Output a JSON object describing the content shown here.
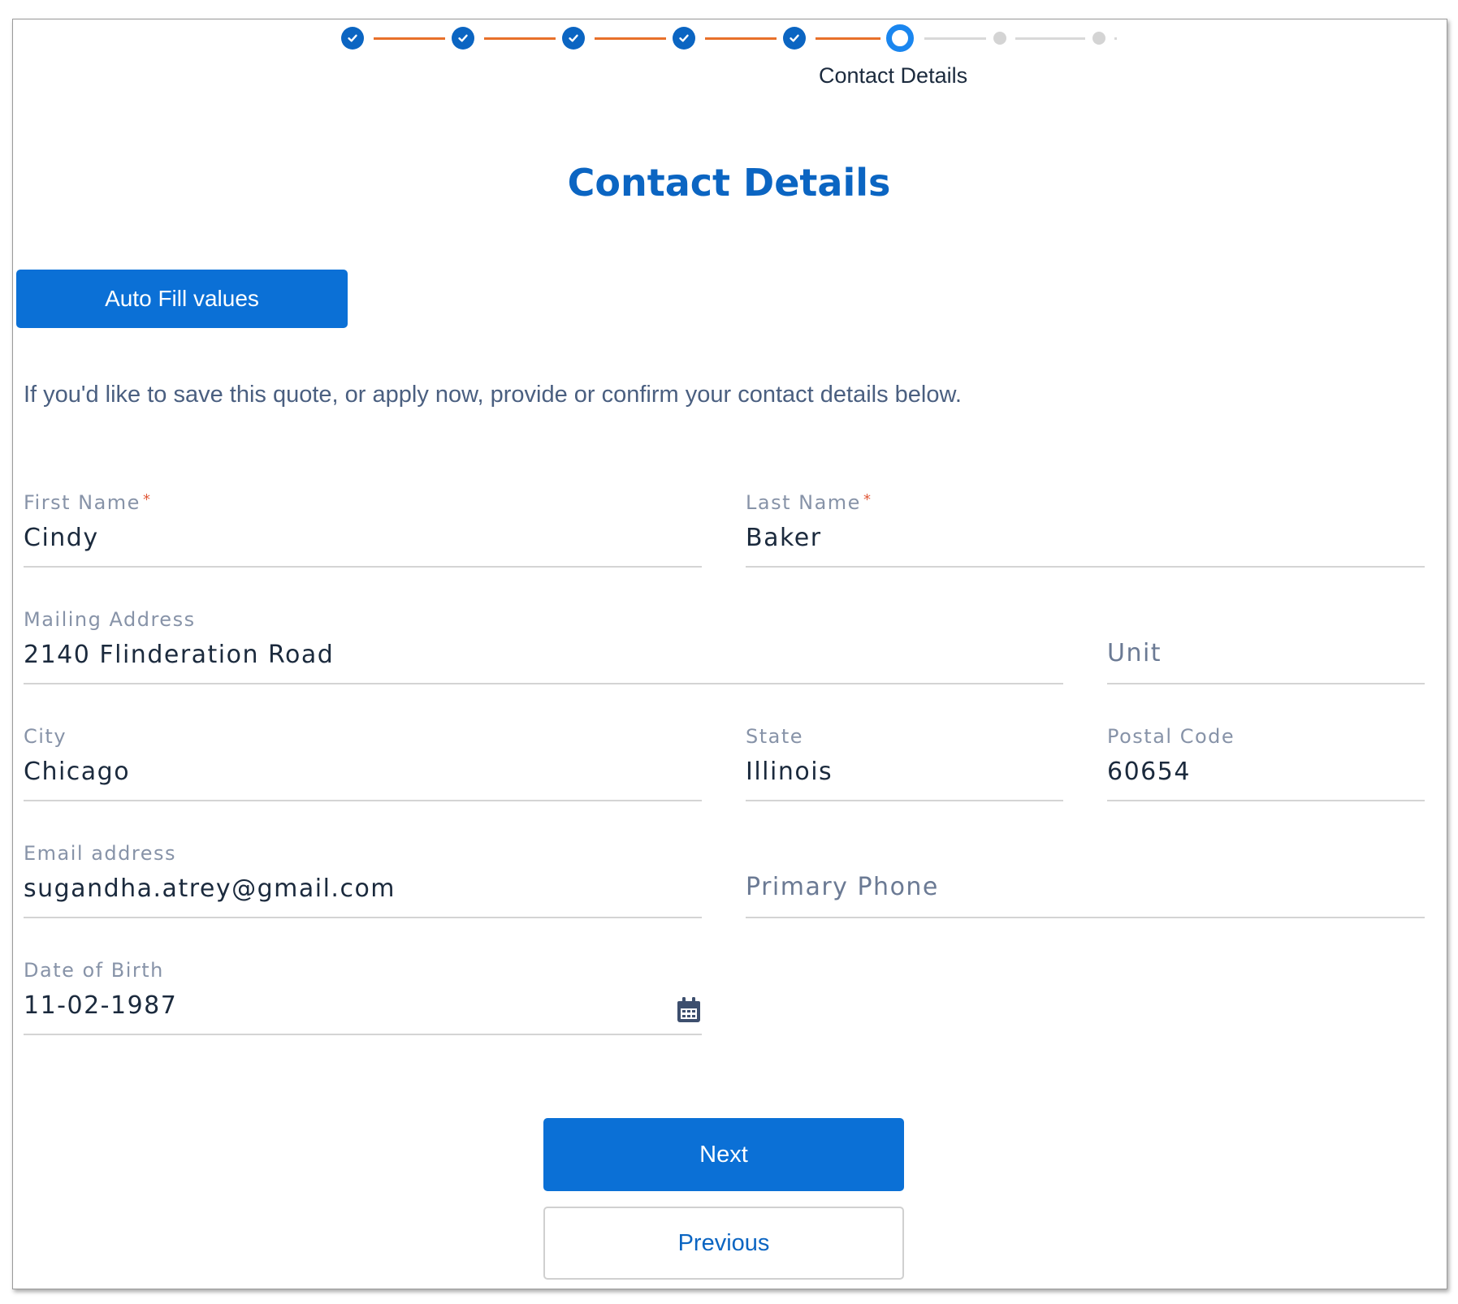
{
  "stepper": {
    "current_step_label": "Contact Details",
    "completed_steps": 5,
    "total_steps": 8,
    "colors": {
      "done": "#0b65c2",
      "line_done": "#e8702a",
      "current": "#1a86ef",
      "todo": "#d4d4d4"
    }
  },
  "page": {
    "title": "Contact Details",
    "intro": "If you'd like to save this quote, or apply now, provide or confirm your contact details below."
  },
  "buttons": {
    "autofill_label": "Auto Fill values",
    "next_label": "Next",
    "previous_label": "Previous"
  },
  "form": {
    "first_name": {
      "label": "First Name",
      "required_mark": "*",
      "value": "Cindy"
    },
    "last_name": {
      "label": "Last Name",
      "required_mark": "*",
      "value": "Baker"
    },
    "mailing_address": {
      "label": "Mailing Address",
      "value": "2140 Flinderation Road"
    },
    "unit": {
      "placeholder": "Unit"
    },
    "city": {
      "label": "City",
      "value": "Chicago"
    },
    "state": {
      "label": "State",
      "value": "Illinois"
    },
    "postal_code": {
      "label": "Postal Code",
      "value": "60654"
    },
    "email": {
      "label": "Email address",
      "value": "sugandha.atrey@gmail.com"
    },
    "primary_phone": {
      "placeholder": "Primary Phone"
    },
    "date_of_birth": {
      "label": "Date of Birth",
      "value": "11-02-1987",
      "icon": "calendar-icon"
    }
  },
  "colors": {
    "accent": "#0b65c2",
    "button": "#0b70d6",
    "progress_line": "#e8702a",
    "required": "#e05a3a"
  }
}
